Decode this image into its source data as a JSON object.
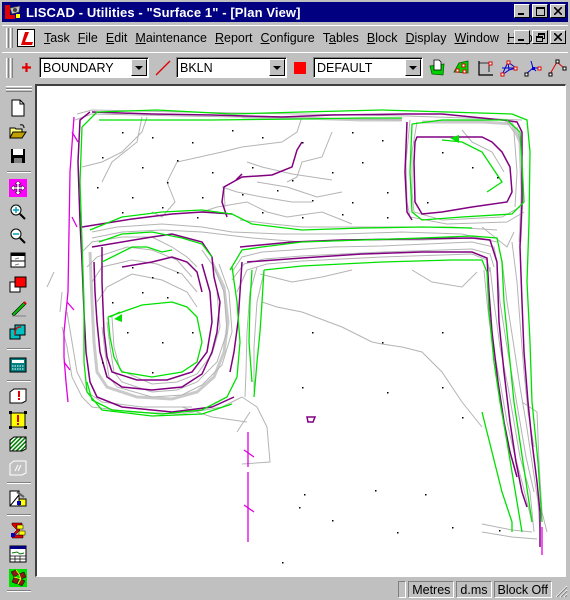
{
  "window": {
    "title": "LISCAD - Utilities - \"Surface 1\" - [Plan View]",
    "app_icon": "liscad-app-icon",
    "controls": [
      "minimize",
      "maximize",
      "close"
    ]
  },
  "menubar": {
    "items": [
      {
        "label": "Task",
        "mnemonic": "T"
      },
      {
        "label": "File",
        "mnemonic": "F"
      },
      {
        "label": "Edit",
        "mnemonic": "E"
      },
      {
        "label": "Maintenance",
        "mnemonic": "M"
      },
      {
        "label": "Report",
        "mnemonic": "R"
      },
      {
        "label": "Configure",
        "mnemonic": "C"
      },
      {
        "label": "Tables",
        "mnemonic": "a"
      },
      {
        "label": "Block",
        "mnemonic": "B"
      },
      {
        "label": "Display",
        "mnemonic": "D"
      },
      {
        "label": "Window",
        "mnemonic": "W"
      },
      {
        "label": "Help",
        "mnemonic": "H"
      }
    ],
    "mdi_controls": [
      "minimize",
      "restore",
      "close"
    ]
  },
  "toolbar": {
    "point_code": "BOUNDARY",
    "line_code": "BKLN",
    "layer": "DEFAULT",
    "layer_color": "#ff0000",
    "tools": [
      "new-surface-icon",
      "surface-points-icon",
      "axis-icon",
      "triangle-network-icon",
      "radial-points-icon",
      "polyline-icon"
    ]
  },
  "left_toolbar": {
    "tools": [
      "new-file-icon",
      "open-folder-icon",
      "save-disk-icon",
      "pan-icon",
      "zoom-in-icon",
      "zoom-out-icon",
      "window-split-icon",
      "layer-color-icon",
      "pencil-icon",
      "copy-rotate-icon",
      "calculator-icon",
      "warning-outline-icon",
      "warning-yellow-icon",
      "hatch-icon",
      "disabled-tool-icon",
      "property-tool-icon",
      "code-list-icon",
      "profile-table-icon",
      "surface-mesh-icon"
    ]
  },
  "plan_view": {
    "colors": {
      "contour_minor": "#b4b4b4",
      "breakline_green": "#00e000",
      "contour_major": "#800080",
      "boundary_magenta": "#e000e0",
      "points": "#000000"
    }
  },
  "statusbar": {
    "units": "Metres",
    "angles": "d.ms",
    "block": "Block Off"
  }
}
